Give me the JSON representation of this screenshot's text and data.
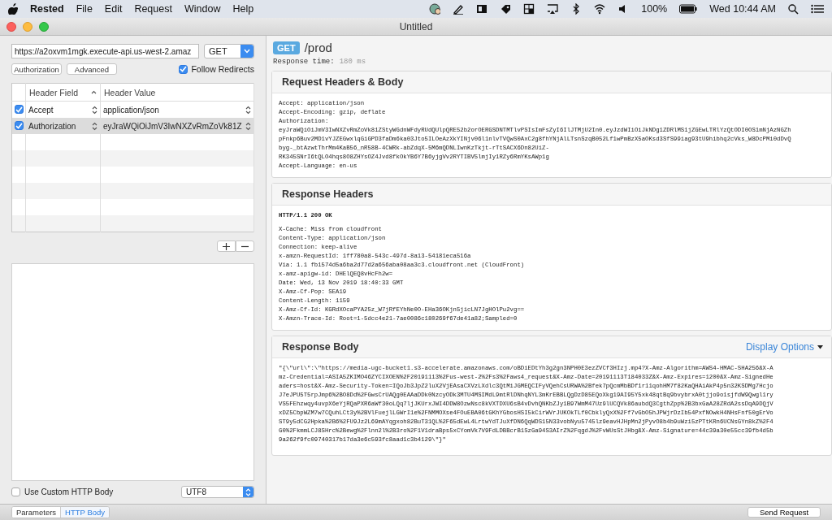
{
  "menu_bar": {
    "app": "Rested",
    "items": [
      "File",
      "Edit",
      "Request",
      "Window",
      "Help"
    ],
    "battery": "100%",
    "clock": "Wed 10:44 AM"
  },
  "window": {
    "title": "Untitled"
  },
  "request": {
    "url": "https://a2oxvm1mgk.execute-api.us-west-2.amaz",
    "method": "GET",
    "buttons": [
      "Authorization",
      "Advanced"
    ],
    "follow_redirects": {
      "label": "Follow Redirects",
      "checked": true
    },
    "headers_table": {
      "columns": [
        "Header Field",
        "Header Value"
      ],
      "rows": [
        {
          "checked": true,
          "field": "Accept",
          "value": "application/json",
          "selected": false
        },
        {
          "checked": true,
          "field": "Authorization",
          "value": "eyJraWQiOiJmV3IwNXZvRmZoVk81Z",
          "selected": true
        }
      ]
    },
    "custom_body": {
      "label": "Use Custom HTTP Body",
      "checked": false
    },
    "encoding": "UTF8"
  },
  "response": {
    "method": "GET",
    "path": "/prod",
    "time_label": "Response time:",
    "time_value": "180 ms",
    "sections": [
      {
        "kind": "plain",
        "title": "Request Headers & Body",
        "lines": [
          "Accept: application/json",
          "Accept-Encoding: gzip, deflate",
          "Authorization:",
          "eyJraWQiOiJmV3IwNXZvRmZoVk81ZStyWGdnWFdyRUdQUlpQRE52b2orOERGSDNTMTlvPSIsImFsZyI6IlJTMjU2In0.eyJzdWIiOiJkNDg1ZDRlMS1jZGEwLTRlYzQtODI0OS1mNjAzNGZh",
          "pFnkp6Buv2MD1vYJZEGwxlqGiGPD3faDm6ka03Jto5ILOeAzXkYINjv06l1nlvTVQwS0AxC2g8fhYNjAlLTsnSzqB052Lf1wPmBzX5aOKsd3SfS99iag93tU9hibhq2cVks_W8DcPMi0dDvQ",
          "byg-_btAzwtThrMm4KaB56_nR58B-4CWRk-abZdqX-5M6mQDNLIwnKzTkjt-rTtSACX6Dn82UiZ-",
          "RK345SNrI6tQLO4hqs8O8ZHYsOZ4Jvd8fkOkYB6Y7B6yjgVv2RYTIBV5lmjIy1RZy6RmYKsAWp1g",
          "Accept-Language: en-us"
        ]
      },
      {
        "kind": "status",
        "title": "Response Headers",
        "status": "HTTP/1.1 200 OK",
        "lines": [
          "X-Cache: Miss from cloudfront",
          "Content-Type: application/json",
          "Connection: keep-alive",
          "x-amzn-RequestId: 1ff780a8-543c-497d-8a13-54181eca516a",
          "Via: 1.1 fb1574d5a6ba2d77d2a656aba08aa3c3.cloudfront.net (CloudFront)",
          "x-amz-apigw-id: DHElQEQ8vHcFh2w=",
          "Date: Wed, 13 Nov 2019 18:40:33 GMT",
          "X-Amz-Cf-Pop: SEA19",
          "Content-Length: 1159",
          "X-Amz-Cf-Id: KGRdXOcaPYA25z_W7jRfEYhNe0O-EHa36OKjn5jicLN7JgHOlPu2vg==",
          "X-Amzn-Trace-Id: Root=1-5dcc4e21-7ae0086c180269f67de41a82;Sampled=0"
        ]
      },
      {
        "kind": "body",
        "title": "Response Body",
        "action": "Display Options",
        "lines": [
          "\"{\\\"url\\\":\\\"https://media-ugc-bucket1.s3-accelerate.amazonaws.com/oBDiEDtYh3g2gn3NPH0E3ezZVCf3HIzj.mp4?X-Amz-Algorithm=AWS4-HMAC-SHA256&X-A",
          "mz-Credential=ASIA5ZKIMO46ZYCIXOEN%2F20191113%2Fus-west-2%2Fs3%2Faws4_request&X-Amz-Date=20191113T184033Z&X-Amz-Expires=1200&X-Amz-SignedHe",
          "aders=host&X-Amz-Security-Token=IQoJb3JpZ2luX2VjEAsaCXVzLXdlc3QtMiJGMEQCIFyVQehCsURWA%2Bfek7pQcmMbBDf1r11qohHM7f82KaQHAiAkP4p5n32KSDMg7Hcjo",
          "J7eJPU5T5rpJmp6%2BO8Dd%2FGwsCrUAQg0EAAaDDk0NzcyODk3MTU4MSIMdL9mtRlDNhqNYL3mKrEBBLQgDzD85EQoXkg19AI95Y5xk48qtBq9bvybrxA0tjjo9o1sjfdW9Qwgl1ry",
          "VS5FEhzwqy4uvpX6eYjRQaPXR6aWf30oLQq7ljJKUrxJWI4DDW8OzwNsc8kVXTDXU6sB4vDvhQNKbZJy1B97WmM47Uz9lUCQVk86aubdQ3CgthZpp%2B3bxGaA28ZRdA2ssDqA9DQjV",
          "xDZ5CbpWZM7w7CQuhLCt3y%2BVlFuejlLGWrI1e%2FNMMOXse4FOuEBA06tGKhYGbosHSI5kCirWVrJUKOkTLf0CbklyQxX%2Ff7vGbO5hJPWjrDzIb54PxfNOwkH4NHsFnf50gErVo",
          "ST9y5dCG2Hpka%2B6%2FU9Jz2L69mAYqgxoh82BuT31QL%2F65dEwL4LrtwYdTJuXfDN6QqWDS15N33vobNyu5745lz9eavHJHpMn2jPyvO8b4b9uWzi5zPTtKRn6UCNsGYn8kZ%2F4",
          "G0%2FkmmLCJ8SHrc%2Bewg%2Flnn2l%2B3ro%2F1V1draBps5xCYomVk7V9FdLDBBcrB1SzGa94S3AIrZ%2FqgdJ%2FvWUsStJHbg&X-Amz-Signature=44c39a30e55cc39fb4d5b",
          "9a262f9fc09740317b17da3e6c593fc8aad1c3b4129\\\"}\""
        ]
      }
    ]
  },
  "bottom_bar": {
    "tabs": [
      {
        "label": "Parameters",
        "selected": false
      },
      {
        "label": "HTTP Body",
        "selected": true
      }
    ],
    "send_button": "Send Request"
  }
}
